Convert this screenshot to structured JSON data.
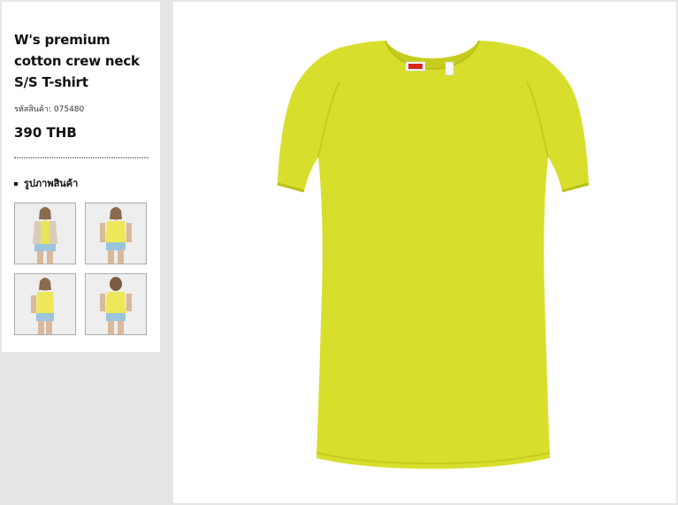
{
  "product": {
    "title": "W's premium cotton crew neck S/S T-shirt",
    "sku_label": "รหัสสินค้า:",
    "sku_value": "075480",
    "price": "390 THB"
  },
  "gallery": {
    "section_label": "รูปภาพสินค้า",
    "thumbnails": [
      {
        "name": "model-front-with-cardigan"
      },
      {
        "name": "model-front"
      },
      {
        "name": "model-side"
      },
      {
        "name": "model-back"
      }
    ]
  },
  "main_image": {
    "name": "yellow-crew-neck-t-shirt",
    "tag_brand": "UNIQLO",
    "garment_color": "#d8de2c"
  },
  "colors": {
    "background": "#e6e6e6",
    "panel": "#ffffff",
    "shirt": "#d8de2c",
    "shirt_shadow": "#c5cc1e"
  }
}
